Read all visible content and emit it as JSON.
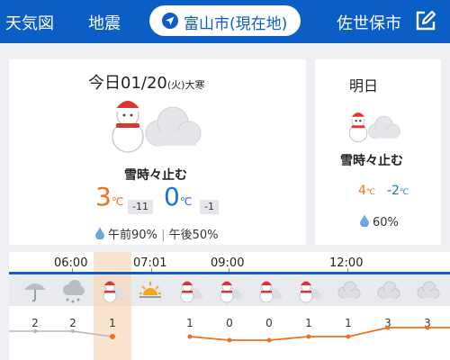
{
  "header": {
    "weather_map": "天気図",
    "earthquake": "地震",
    "location": "富山市(現在地)",
    "other_city": "佐世保市",
    "edit_icon": "edit-icon",
    "bg_color": "#0b5ec5"
  },
  "today": {
    "date_prefix": "今日",
    "date": "01/20",
    "weekday": "(火)",
    "note": "大寒",
    "weather": "雪時々止む",
    "icon": "snowman-cloud-icon",
    "temp_high": "3",
    "temp_high_diff": "-11",
    "temp_low": "0",
    "temp_low_diff": "-1",
    "temp_unit": "℃",
    "rain_am_label": "午前",
    "rain_am": "90%",
    "rain_sep": "|",
    "rain_pm_label": "午後",
    "rain_pm": "50%"
  },
  "tomorrow": {
    "title": "明日",
    "weather": "雪時々止む",
    "icon": "snowman-cloud-icon",
    "temp_high": "4",
    "temp_low": "-2",
    "temp_unit": "℃",
    "rain": "60%"
  },
  "hourly": {
    "time_labels": [
      "06:00",
      "07:01",
      "09:00",
      "12:00"
    ],
    "icons": [
      "umbrella-icon",
      "snow-cloud-icon",
      "snowman-icon",
      "sunrise-icon",
      "snowman-icon",
      "snowman-icon",
      "snowman-icon",
      "snowman-icon",
      "cloud-icon",
      "cloud-icon",
      "cloud-icon"
    ],
    "precip_values": [
      "2",
      "2",
      "1",
      "1",
      "0",
      "0",
      "1",
      "1",
      "3",
      "3"
    ],
    "colors": {
      "past": "#aaaaaa",
      "future": "#f0701d",
      "now": "#fbe4cf"
    }
  }
}
